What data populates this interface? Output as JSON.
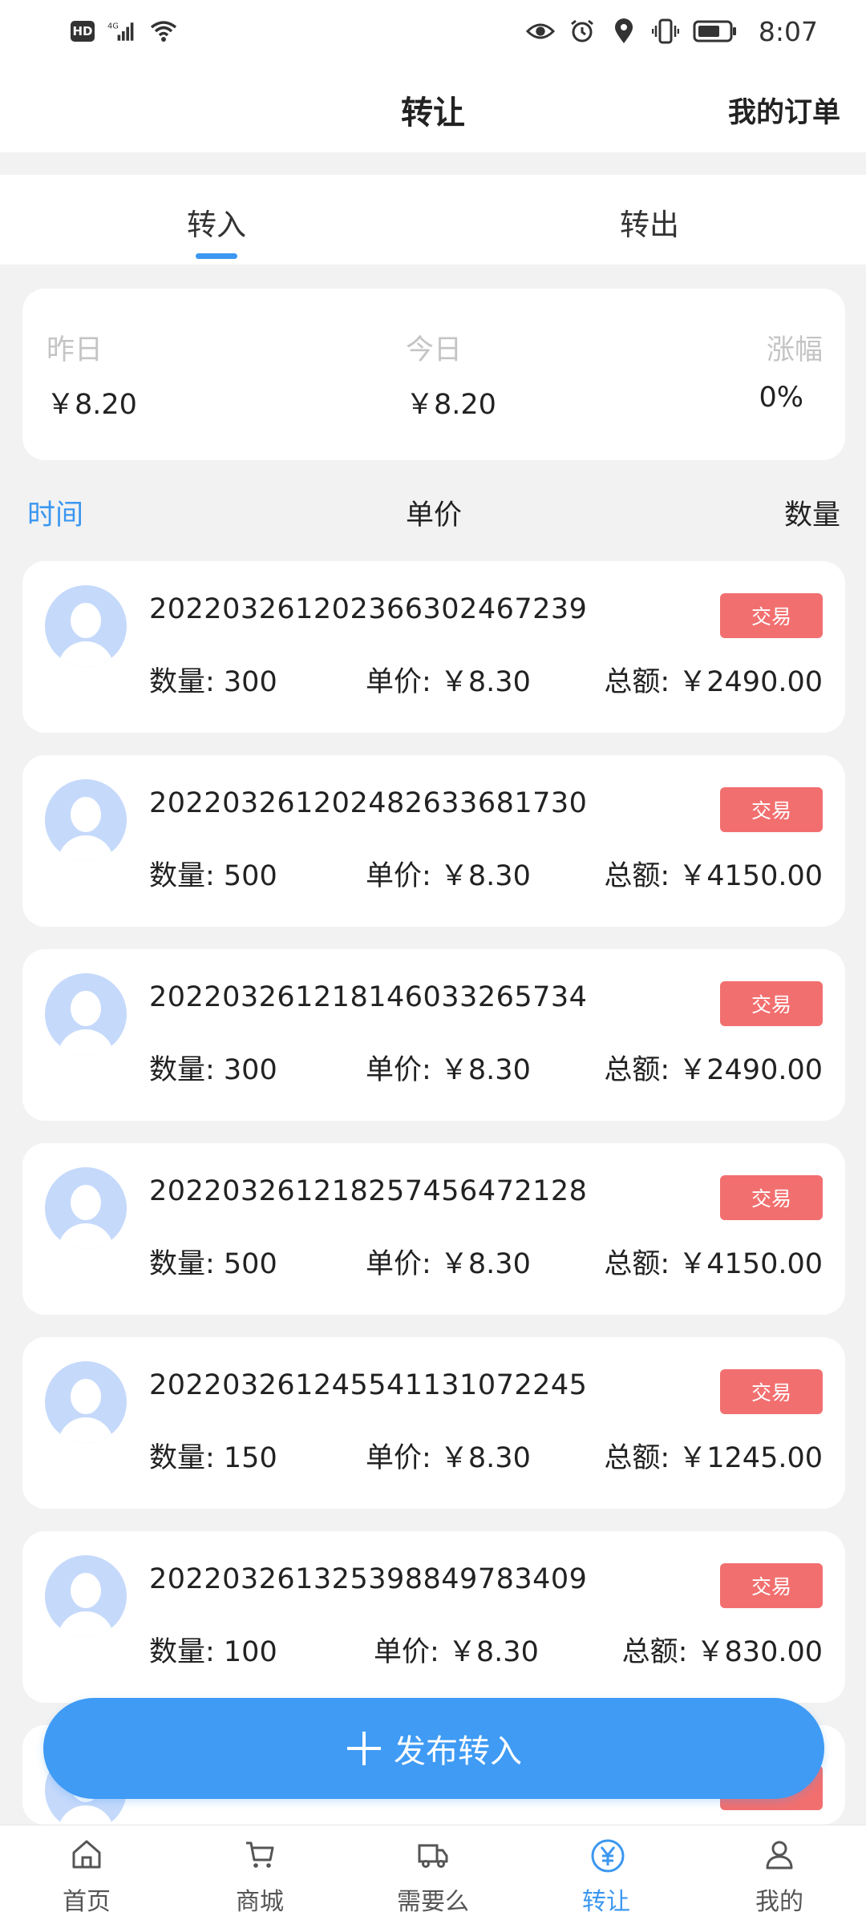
{
  "status_bar": {
    "left_badges": [
      "HD",
      "4G"
    ],
    "time": "8:07"
  },
  "header": {
    "title": "转让",
    "orders_link": "我的订单"
  },
  "tabs": [
    {
      "label": "转入",
      "active": true
    },
    {
      "label": "转出",
      "active": false
    }
  ],
  "summary": {
    "yesterday_label": "昨日",
    "yesterday_value": "￥8.20",
    "today_label": "今日",
    "today_value": "￥8.20",
    "change_label": "涨幅",
    "change_value": "0%"
  },
  "columns": {
    "time": "时间",
    "price": "单价",
    "quantity": "数量"
  },
  "orders": [
    {
      "id": "20220326120236630246723 9",
      "qty": "数量: 300",
      "price": "单价: ￥8.30",
      "total": "总额: ￥2490.00",
      "action": "交易"
    },
    {
      "id": "202203261202482633681730",
      "qty": "数量: 500",
      "price": "单价: ￥8.30",
      "total": "总额: ￥4150.00",
      "action": "交易"
    },
    {
      "id": "202203261218146033265734",
      "qty": "数量: 300",
      "price": "单价: ￥8.30",
      "total": "总额: ￥2490.00",
      "action": "交易"
    },
    {
      "id": "202203261218257456472128",
      "qty": "数量: 500",
      "price": "单价: ￥8.30",
      "total": "总额: ￥4150.00",
      "action": "交易"
    },
    {
      "id": "202203261245541131072245",
      "qty": "数量: 150",
      "price": "单价: ￥8.30",
      "total": "总额: ￥1245.00",
      "action": "交易"
    },
    {
      "id": "202203261325398849783409",
      "qty": "数量: 100",
      "price": "单价: ￥8.30",
      "total": "总额: ￥830.00",
      "action": "交易"
    }
  ],
  "publish_button": "发布转入",
  "bottom_nav": [
    {
      "label": "首页",
      "icon": "home-icon",
      "active": false
    },
    {
      "label": "商城",
      "icon": "cart-icon",
      "active": false
    },
    {
      "label": "需要么",
      "icon": "truck-icon",
      "active": false
    },
    {
      "label": "转让",
      "icon": "yuan-icon",
      "active": true
    },
    {
      "label": "我的",
      "icon": "user-icon",
      "active": false
    }
  ],
  "colors": {
    "accent": "#3b97f0",
    "trade_button": "#f26f6f",
    "avatar": "#c5d9fb"
  }
}
